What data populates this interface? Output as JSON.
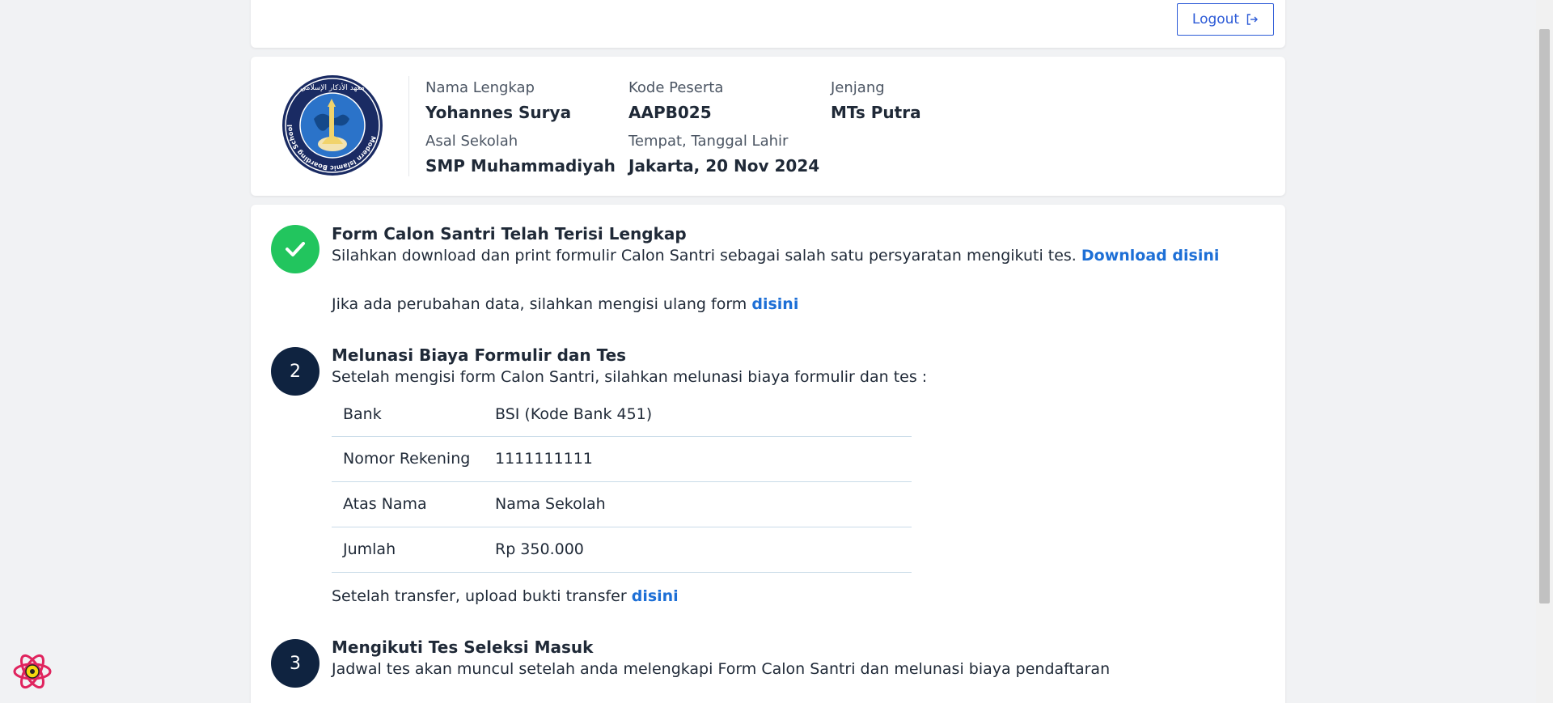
{
  "header": {
    "logout_label": "Logout"
  },
  "profile": {
    "logo_alt": "Modern Islamic Boarding School",
    "logo_text_ring": "Modern Islamic Boarding School",
    "logo_arabic": "معهد الأذكار الإسلامي",
    "fields": {
      "nama_label": "Nama Lengkap",
      "nama_value": "Yohannes Surya",
      "kode_label": "Kode Peserta",
      "kode_value": "AAPB025",
      "jenjang_label": "Jenjang",
      "jenjang_value": "MTs Putra",
      "asal_label": "Asal Sekolah",
      "asal_value": "SMP Muhammadiyah",
      "ttl_label": "Tempat, Tanggal Lahir",
      "ttl_value": "Jakarta, 20 Nov 2024"
    }
  },
  "steps": {
    "step1": {
      "title": "Form Calon Santri Telah Terisi Lengkap",
      "text": "Silahkan download dan print formulir Calon Santri sebagai salah satu persyaratan mengikuti tes.",
      "download_link": "Download disini",
      "change_text": "Jika ada perubahan data, silahkan mengisi ulang form",
      "change_link": "disini"
    },
    "step2": {
      "number": "2",
      "title": "Melunasi Biaya Formulir dan Tes",
      "text": "Setelah mengisi form Calon Santri, silahkan melunasi biaya formulir dan tes :",
      "bank": {
        "bank_label": "Bank",
        "bank_value": "BSI (Kode Bank 451)",
        "rek_label": "Nomor Rekening",
        "rek_value": "1111111111",
        "nama_label": "Atas Nama",
        "nama_value": "Nama Sekolah",
        "jumlah_label": "Jumlah",
        "jumlah_value": "Rp 350.000"
      },
      "upload_text": "Setelah transfer, upload bukti transfer",
      "upload_link": "disini"
    },
    "step3": {
      "number": "3",
      "title": "Mengikuti Tes Seleksi Masuk",
      "text": "Jadwal tes akan muncul setelah anda melengkapi Form Calon Santri dan melunasi biaya pendaftaran"
    }
  },
  "colors": {
    "accent": "#1d6fd6",
    "success": "#22c55e",
    "navy": "#0f2340"
  }
}
